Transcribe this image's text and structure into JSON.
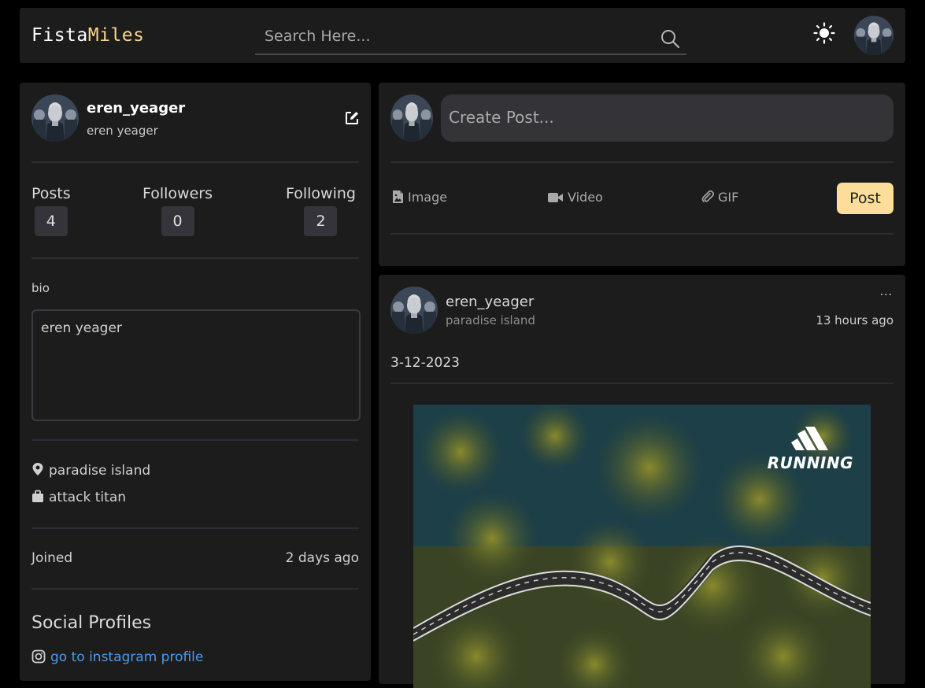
{
  "navbar": {
    "logo_part1": "Fista",
    "logo_part2": "Miles",
    "search_placeholder": "Search Here...",
    "icons": [
      "search-icon",
      "sun-icon"
    ]
  },
  "profile": {
    "username": "eren_yeager",
    "name": "eren yeager",
    "stats": [
      {
        "label": "Posts",
        "value": "4"
      },
      {
        "label": "Followers",
        "value": "0"
      },
      {
        "label": "Following",
        "value": "2"
      }
    ],
    "bio_label": "bio",
    "bio": "eren yeager",
    "location": "paradise island",
    "occupation": "attack titan",
    "joined_label": "Joined",
    "joined_value": "2 days ago",
    "social_title": "Social Profiles",
    "instagram_link": "go to instagram profile"
  },
  "create_post": {
    "placeholder": "Create Post...",
    "actions": {
      "image": "Image",
      "video": "Video",
      "gif": "GIF"
    },
    "post_button": "Post"
  },
  "feed": {
    "post": {
      "username": "eren_yeager",
      "location": "paradise island",
      "time": "13 hours ago",
      "more": "···",
      "caption": "3-12-2023",
      "image_brand": "RUNNING"
    }
  },
  "colors": {
    "accent": "#f6d58f",
    "post_button": "#fddd9a",
    "link": "#4b9bf0",
    "card_bg": "#1c1c1c",
    "page_bg": "#000000"
  }
}
